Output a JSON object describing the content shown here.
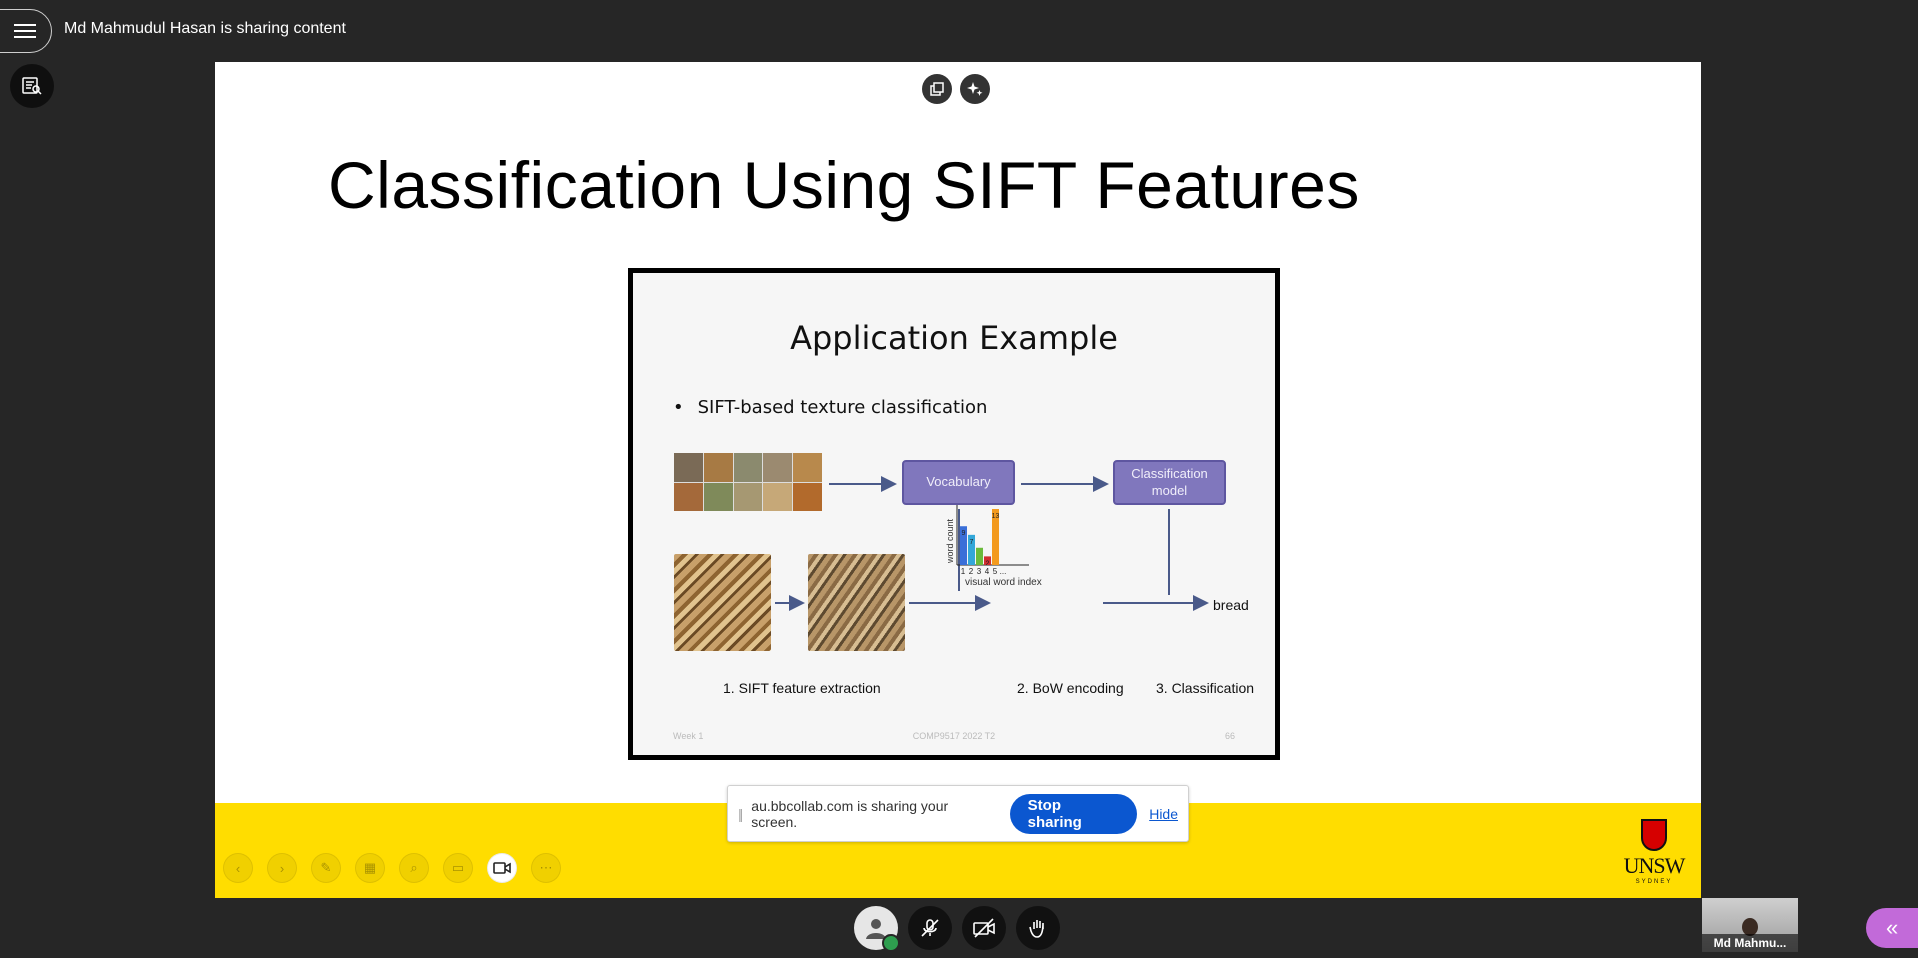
{
  "header": {
    "sharing_title": "Md Mahmudul Hasan is sharing content"
  },
  "slide": {
    "title": "Classification Using SIFT Features",
    "inner": {
      "title": "Application Example",
      "bullet": "SIFT-based texture classification",
      "vocabulary_box": "Vocabulary",
      "model_box_line1": "Classification",
      "model_box_line2": "model",
      "output_label": "bread",
      "step1": "1. SIFT feature extraction",
      "step2": "2. BoW encoding",
      "step3": "3. Classification",
      "footer_left": "Week 1",
      "footer_center": "COMP9517 2022 T2",
      "footer_right": "66",
      "histogram": {
        "ylabel": "word count",
        "xlabel": "visual word index",
        "x_ticks": [
          "1",
          "2",
          "3",
          "4",
          "5",
          "..."
        ],
        "values": [
          9,
          7,
          4,
          2,
          13
        ],
        "value_labels": [
          "9",
          "7",
          "",
          "2",
          "13"
        ],
        "colors": [
          "#3a6fd8",
          "#33a7d9",
          "#6bbb3c",
          "#d02f2f",
          "#f39a1e"
        ]
      }
    }
  },
  "share_notice": {
    "text": "au.bbcollab.com is sharing your screen.",
    "stop_label": "Stop sharing",
    "hide_label": "Hide"
  },
  "self_view": {
    "name": "Md Mahmu..."
  },
  "icons": {
    "menu": "hamburger-menu-icon",
    "captions": "captions-icon",
    "panel_toggle": "double-chevron-left-icon"
  },
  "colors": {
    "accent_yellow": "#ffdd00",
    "stop_blue": "#0b57d0",
    "panel_purple": "#c26ad9",
    "box_purple": "#8077bd"
  }
}
